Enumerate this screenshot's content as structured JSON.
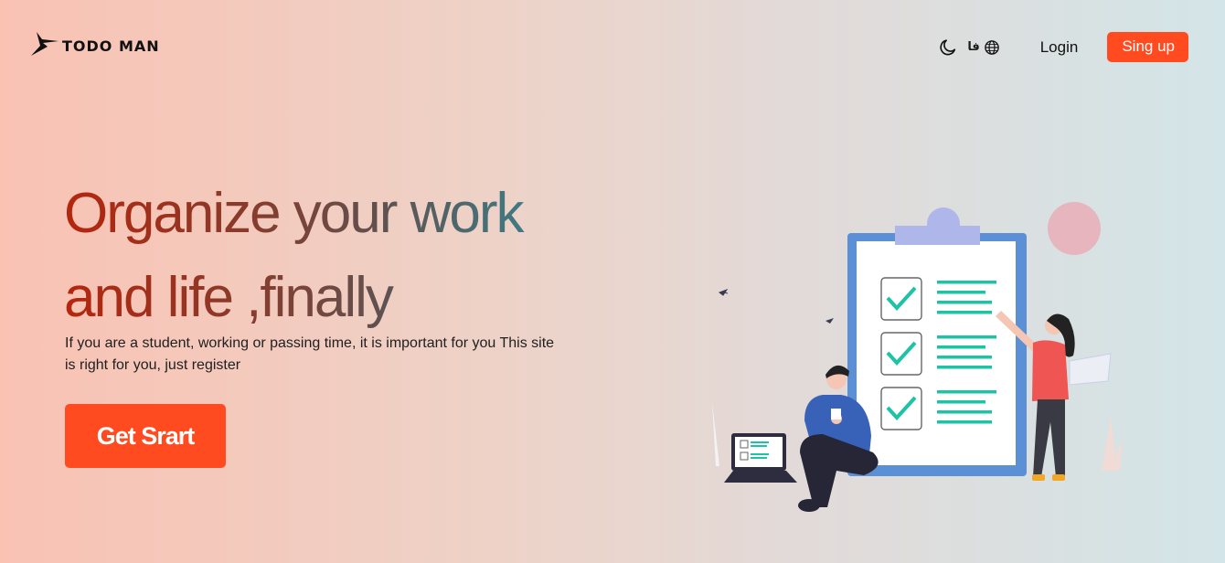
{
  "header": {
    "logo_text": "TODO MAN",
    "logo_icon": "bolt-logo-icon",
    "theme_icon": "moon-icon",
    "lang_label": "فا",
    "lang_icon": "globe-icon",
    "login_label": "Login",
    "signup_label": "Sing up"
  },
  "hero": {
    "title_line1": "Organize your work",
    "title_line2": "and life ,finally",
    "subtitle": "If you are a student, working or passing time, it is important for you This site is right for you, just register",
    "cta_label": "Get Srart"
  },
  "colors": {
    "accent": "#ff4b1f",
    "title_start": "#b5260e",
    "title_end": "#3e7c86",
    "check": "#1cc3a5",
    "clipboard": "#5b8fd6"
  }
}
